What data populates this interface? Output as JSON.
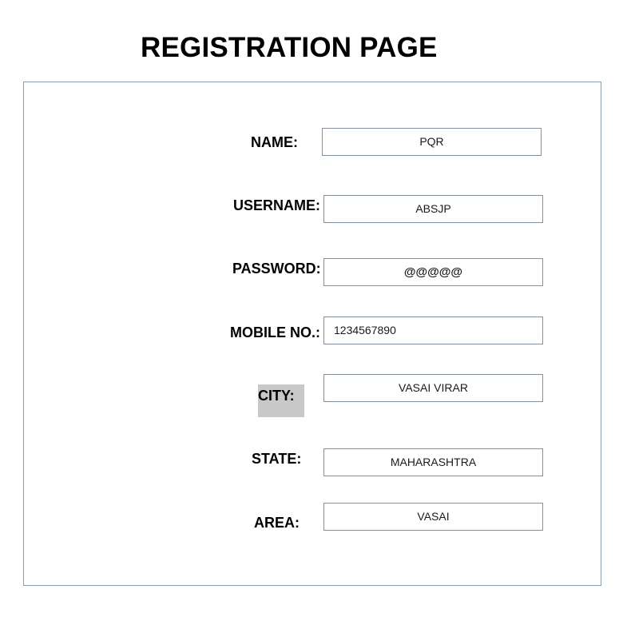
{
  "page": {
    "title": "REGISTRATION PAGE"
  },
  "form": {
    "name": {
      "label": "NAME:",
      "value": "PQR"
    },
    "username": {
      "label": "USERNAME:",
      "value": "ABSJP"
    },
    "password": {
      "label": "PASSWORD:",
      "value": "@@@@@"
    },
    "mobile": {
      "label": "MOBILE NO.:",
      "value": "1234567890"
    },
    "city": {
      "label": "CITY:",
      "value": "VASAI VIRAR"
    },
    "state": {
      "label": "STATE:",
      "value": "MAHARASHTRA"
    },
    "area": {
      "label": "AREA:",
      "value": "VASAI"
    }
  },
  "colors": {
    "border": "#8a9bb5",
    "city_label_highlight": "#c8c8c8"
  }
}
